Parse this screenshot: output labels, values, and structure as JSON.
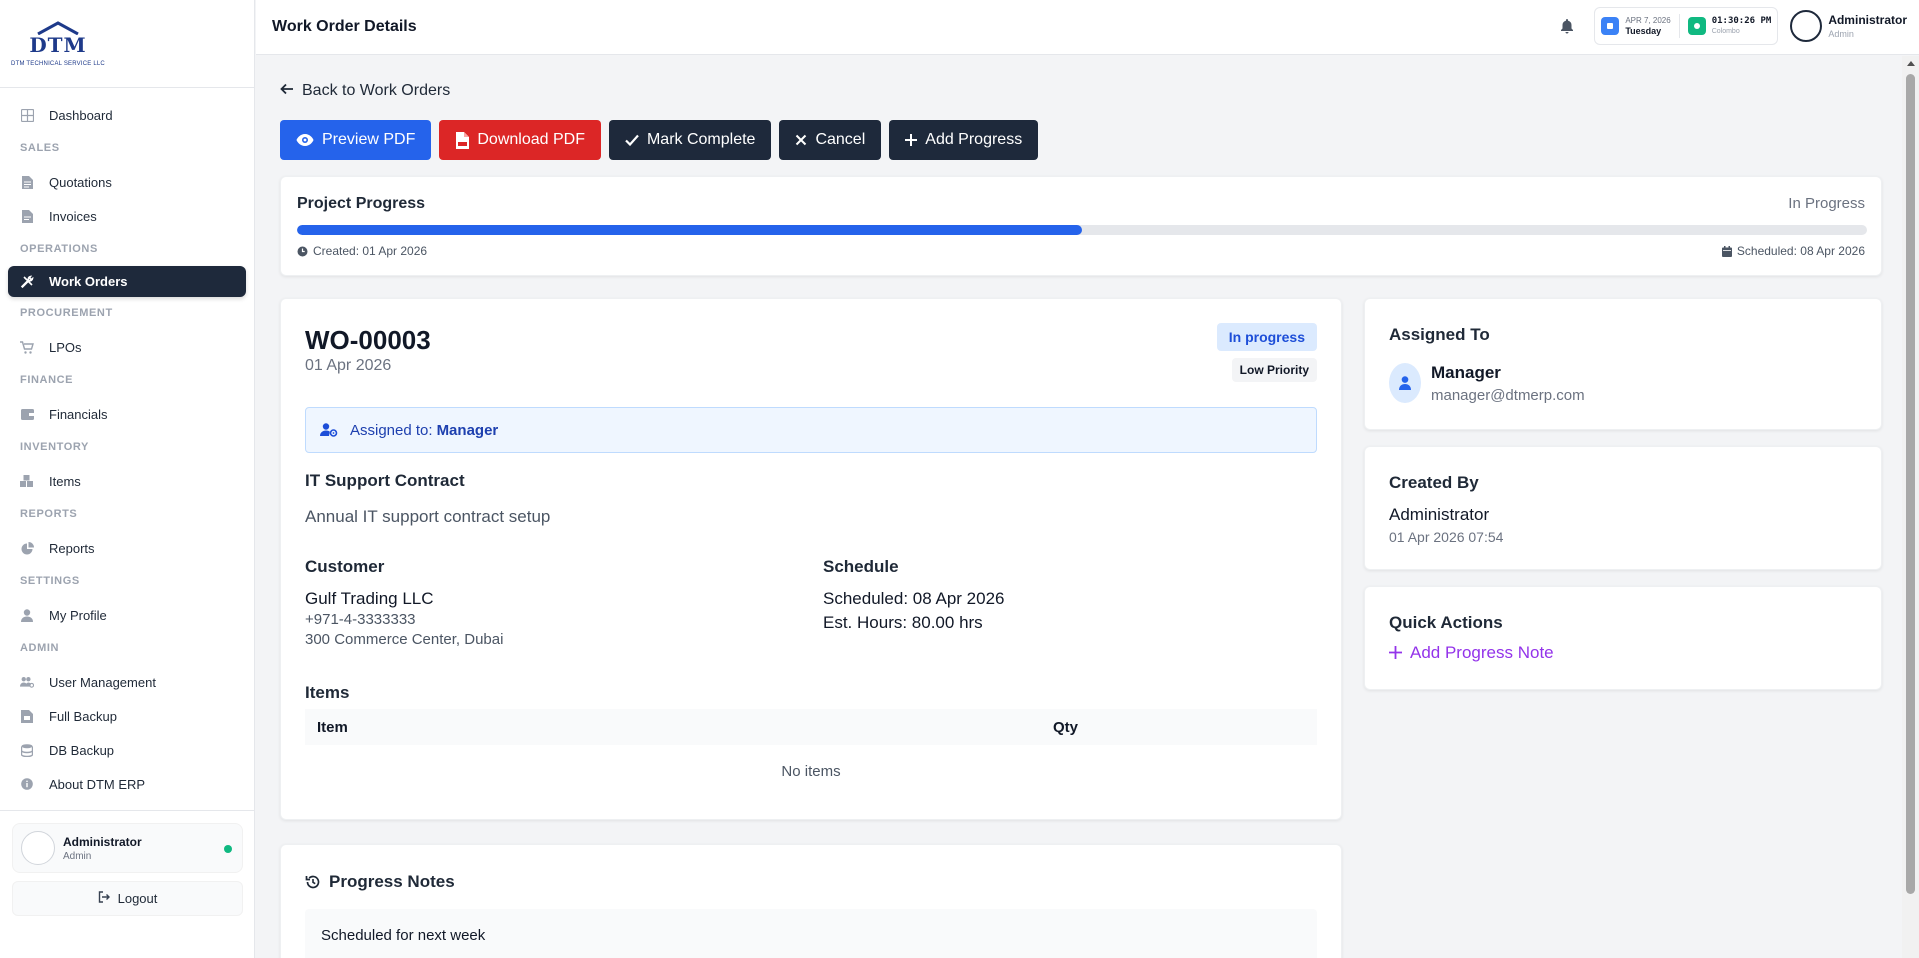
{
  "sidebar": {
    "logo": {
      "mark": "DTM",
      "subtitle": "DTM TECHNICAL SERVICE LLC"
    },
    "nav": [
      {
        "type": "item",
        "label": "Dashboard",
        "icon": "grid-icon"
      },
      {
        "type": "section",
        "label": "SALES"
      },
      {
        "type": "item",
        "label": "Quotations",
        "icon": "document-icon"
      },
      {
        "type": "item",
        "label": "Invoices",
        "icon": "invoice-icon"
      },
      {
        "type": "section",
        "label": "OPERATIONS"
      },
      {
        "type": "item",
        "label": "Work Orders",
        "icon": "tools-icon",
        "active": true
      },
      {
        "type": "section",
        "label": "PROCUREMENT"
      },
      {
        "type": "item",
        "label": "LPOs",
        "icon": "cart-icon"
      },
      {
        "type": "section",
        "label": "FINANCE"
      },
      {
        "type": "item",
        "label": "Financials",
        "icon": "wallet-icon"
      },
      {
        "type": "section",
        "label": "INVENTORY"
      },
      {
        "type": "item",
        "label": "Items",
        "icon": "boxes-icon"
      },
      {
        "type": "section",
        "label": "REPORTS"
      },
      {
        "type": "item",
        "label": "Reports",
        "icon": "pie-chart-icon"
      },
      {
        "type": "section",
        "label": "SETTINGS"
      },
      {
        "type": "item",
        "label": "My Profile",
        "icon": "user-icon"
      },
      {
        "type": "section",
        "label": "ADMIN"
      },
      {
        "type": "item",
        "label": "User Management",
        "icon": "users-gear-icon"
      },
      {
        "type": "item",
        "label": "Full Backup",
        "icon": "archive-icon"
      },
      {
        "type": "item",
        "label": "DB Backup",
        "icon": "database-icon"
      },
      {
        "type": "item",
        "label": "About DTM ERP",
        "icon": "info-icon"
      }
    ],
    "user": {
      "name": "Administrator",
      "role": "Admin"
    },
    "logout_label": "Logout"
  },
  "header": {
    "title": "Work Order Details",
    "date_line": "APR 7, 2026",
    "day_line": "Tuesday",
    "time": "01:30:26 PM",
    "time_sub": "Colombo",
    "user_name": "Administrator",
    "user_role": "Admin"
  },
  "page": {
    "back_label": "Back to Work Orders",
    "buttons": {
      "preview": "Preview PDF",
      "download": "Download PDF",
      "complete": "Mark Complete",
      "cancel": "Cancel",
      "add_progress": "Add Progress"
    },
    "progress": {
      "title": "Project Progress",
      "status": "In Progress",
      "percent": 50,
      "created": "Created: 01 Apr 2026",
      "scheduled": "Scheduled: 08 Apr 2026"
    },
    "work_order": {
      "number": "WO-00003",
      "date": "01 Apr 2026",
      "status_badge": "In progress",
      "priority_badge": "Low Priority",
      "assigned_prefix": "Assigned to:",
      "assigned_name": "Manager",
      "title": "IT Support Contract",
      "description": "Annual IT support contract setup",
      "customer_heading": "Customer",
      "customer_name": "Gulf Trading LLC",
      "customer_phone": "+971-4-3333333",
      "customer_address": "300 Commerce Center, Dubai",
      "schedule_heading": "Schedule",
      "scheduled": "Scheduled: 08 Apr 2026",
      "est_hours": "Est. Hours: 80.00 hrs",
      "items_heading": "Items",
      "items_columns": [
        "Item",
        "Qty"
      ],
      "items_empty": "No items"
    },
    "notes": {
      "title": "Progress Notes",
      "first_note": "Scheduled for next week"
    },
    "assigned_card": {
      "title": "Assigned To",
      "name": "Manager",
      "email": "manager@dtmerp.com"
    },
    "created_card": {
      "title": "Created By",
      "name": "Administrator",
      "date": "01 Apr 2026 07:54"
    },
    "quick_actions": {
      "title": "Quick Actions",
      "add_note": "Add Progress Note"
    }
  },
  "colors": {
    "primary": "#2563eb",
    "danger": "#dc2626",
    "dark": "#1e293b",
    "accent": "#9333ea"
  }
}
